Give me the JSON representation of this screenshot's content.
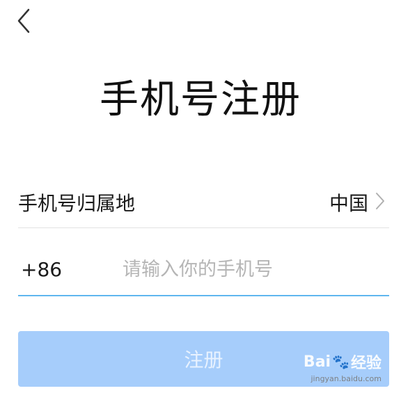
{
  "header": {
    "back_icon": "chevron-left-icon",
    "title": "手机号注册"
  },
  "region": {
    "label": "手机号归属地",
    "value": "中国",
    "chevron_icon": "chevron-right-icon"
  },
  "phone": {
    "country_code": "+86",
    "placeholder": "请输入你的手机号",
    "value": ""
  },
  "register": {
    "label": "注册"
  },
  "watermark": {
    "brand": "Bai",
    "brand_suffix": "经验",
    "url": "jingyan.baidu.com"
  },
  "colors": {
    "accent_underline": "#5fb6ee",
    "button_disabled": "#a6cdfb"
  }
}
